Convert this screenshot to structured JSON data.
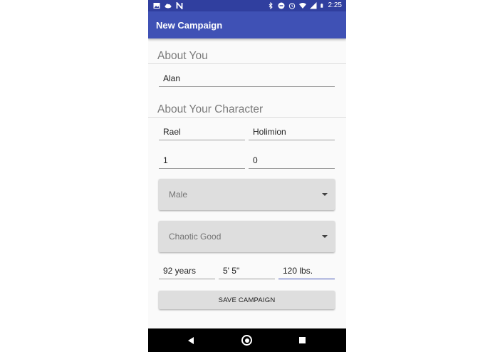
{
  "status_bar": {
    "time": "2:25",
    "battery_level": "8",
    "left_icons": [
      "image-icon",
      "cloud-icon",
      "n-icon"
    ],
    "right_icons": [
      "bluetooth-icon",
      "do-not-disturb-icon",
      "alarm-icon",
      "wifi-icon",
      "signal-icon",
      "battery-icon"
    ]
  },
  "app_bar": {
    "title": "New Campaign"
  },
  "about_you": {
    "heading": "About You",
    "player_name": "Alan"
  },
  "about_character": {
    "heading": "About Your Character",
    "first_name": "Rael",
    "last_name": "Holimion",
    "field_left_number": "1",
    "field_right_number": "0",
    "gender": {
      "selected": "Male"
    },
    "alignment": {
      "selected": "Chaotic Good"
    },
    "age": "92 years",
    "height": "5' 5\"",
    "weight": "120 lbs."
  },
  "actions": {
    "save_label": "SAVE CAMPAIGN"
  },
  "colors": {
    "status_bar": "#303f9f",
    "app_bar": "#3f51b5",
    "accent": "#3f51b5",
    "background": "#fafafa"
  }
}
